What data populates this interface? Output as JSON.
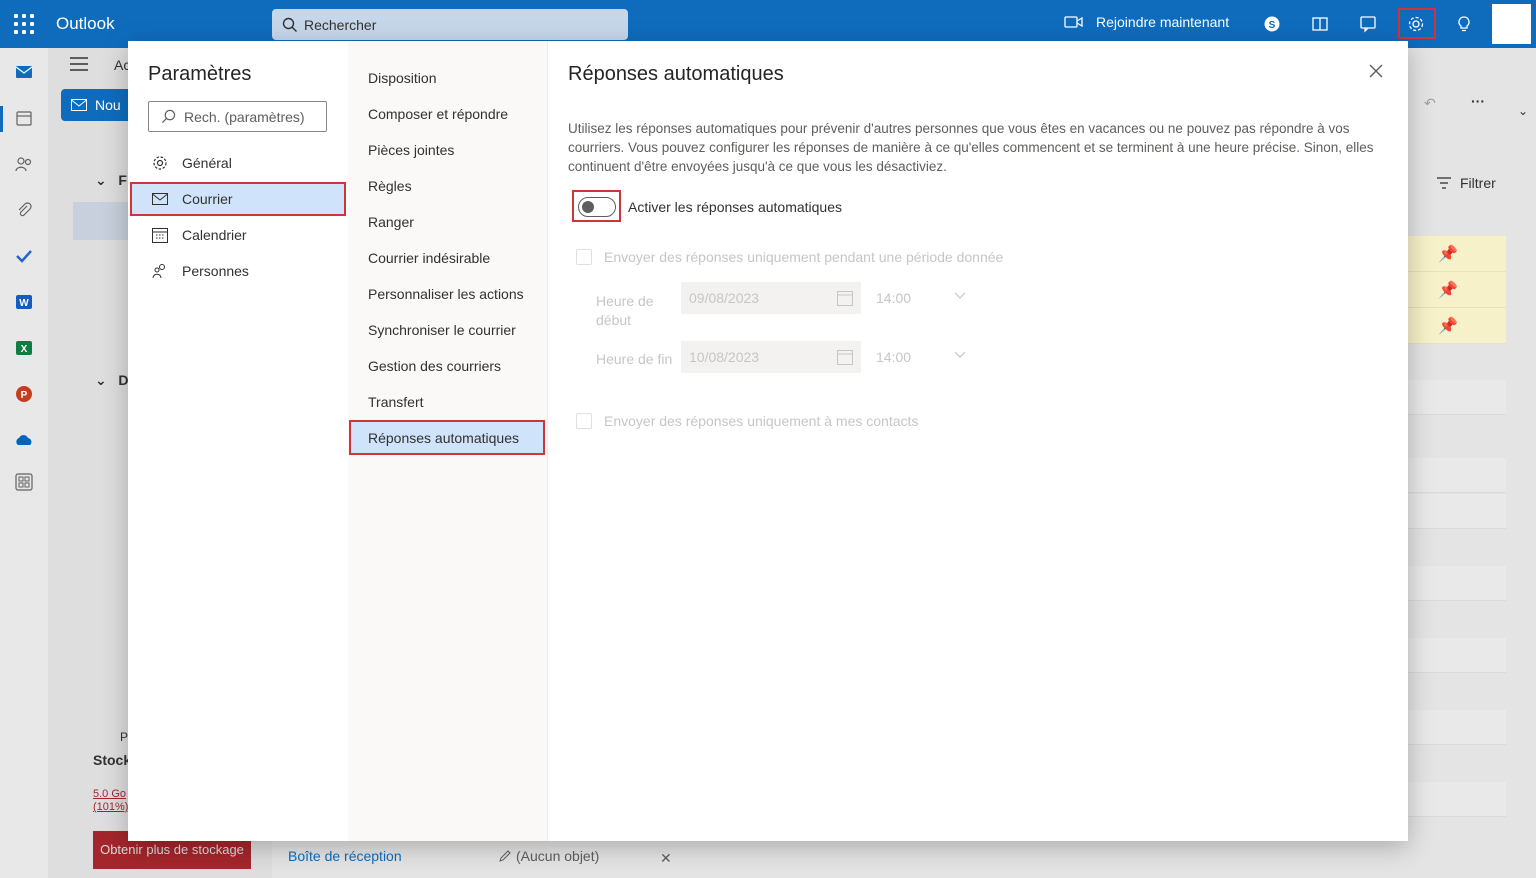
{
  "topbar": {
    "app_name": "Outlook",
    "search_placeholder": "Rechercher",
    "join_label": "Rejoindre maintenant"
  },
  "background": {
    "new_label": "Nou",
    "tab_ac": "Ac",
    "letter_f": "F",
    "letter_d": "D",
    "letter_p": "P",
    "storage_label": "Stock",
    "storage_amount": "5.0 Go",
    "storage_percent": "(101%)",
    "storage_button": "Obtenir plus de stockage",
    "filter_label": "Filtrer",
    "bottom_tab_inbox": "Boîte de réception",
    "bottom_tab_draft": "(Aucun objet)"
  },
  "settings": {
    "title": "Paramètres",
    "search_placeholder": "Rech. (paramètres)",
    "categories": [
      {
        "label": "Général",
        "icon": "gear-icon"
      },
      {
        "label": "Courrier",
        "icon": "mail-icon"
      },
      {
        "label": "Calendrier",
        "icon": "calendar-icon"
      },
      {
        "label": "Personnes",
        "icon": "people-icon"
      }
    ],
    "subcategories": [
      "Disposition",
      "Composer et répondre",
      "Pièces jointes",
      "Règles",
      "Ranger",
      "Courrier indésirable",
      "Personnaliser les actions",
      "Synchroniser le courrier",
      "Gestion des courriers",
      "Transfert",
      "Réponses automatiques"
    ]
  },
  "auto_reply": {
    "title": "Réponses automatiques",
    "description": "Utilisez les réponses automatiques pour prévenir d'autres personnes que vous êtes en vacances ou ne pouvez pas répondre à vos courriers. Vous pouvez configurer les réponses de manière à ce qu'elles commencent et se terminent à une heure précise. Sinon, elles continuent d'être envoyées jusqu'à ce que vous les désactiviez.",
    "toggle_label": "Activer les réponses automatiques",
    "toggle_on": false,
    "period_checkbox_label": "Envoyer des réponses uniquement pendant une période donnée",
    "start_label_1": "Heure de",
    "start_label_2": "début",
    "start_date": "09/08/2023",
    "start_time": "14:00",
    "end_label": "Heure de fin",
    "end_date": "10/08/2023",
    "end_time": "14:00",
    "contacts_checkbox_label": "Envoyer des réponses uniquement à mes contacts"
  },
  "colors": {
    "brand": "#0f6cbd",
    "highlight_border": "#d13438",
    "selected_bg": "#cfe4fa"
  }
}
